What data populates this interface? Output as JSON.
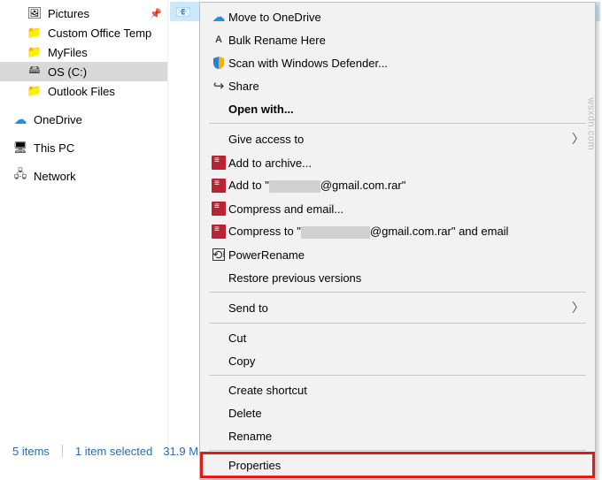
{
  "sidebar": {
    "items": [
      {
        "label": "Pictures",
        "icon": "pictures",
        "pinned": true
      },
      {
        "label": "Custom Office Temp",
        "icon": "folder",
        "pinned": false
      },
      {
        "label": "MyFiles",
        "icon": "folder",
        "pinned": false
      },
      {
        "label": "OS (C:)",
        "icon": "drive",
        "pinned": false,
        "selected": true
      },
      {
        "label": "Outlook Files",
        "icon": "folder",
        "pinned": false
      }
    ],
    "locations": [
      {
        "label": "OneDrive",
        "icon": "onedrive"
      },
      {
        "label": "This PC",
        "icon": "thispc"
      },
      {
        "label": "Network",
        "icon": "network"
      }
    ]
  },
  "selected_file": {
    "icon": "outlook-data-file"
  },
  "context_menu": {
    "move_onedrive": "Move to OneDrive",
    "bulk_rename": "Bulk Rename Here",
    "scan_defender": "Scan with Windows Defender...",
    "share": "Share",
    "open_with": "Open with...",
    "give_access": "Give access to",
    "add_archive": "Add to archive...",
    "add_to_prefix": "Add to \"",
    "add_to_suffix": "@gmail.com.rar\"",
    "compress_email": "Compress and email...",
    "compress_to_prefix": "Compress to \"",
    "compress_to_suffix": "@gmail.com.rar\" and email",
    "power_rename": "PowerRename",
    "restore_prev": "Restore previous versions",
    "send_to": "Send to",
    "cut": "Cut",
    "copy": "Copy",
    "create_shortcut": "Create shortcut",
    "delete": "Delete",
    "rename": "Rename",
    "properties": "Properties"
  },
  "statusbar": {
    "items_count": "5 items",
    "selected": "1 item selected",
    "size": "31.9 M"
  },
  "watermark": "wsxdn.com"
}
